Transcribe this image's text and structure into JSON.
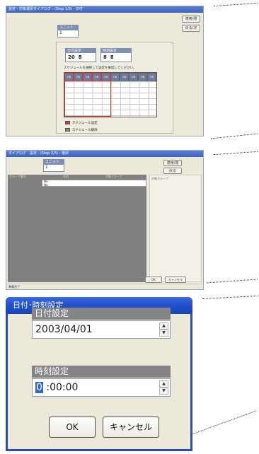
{
  "window1": {
    "title": "設定 - 対象選択ダイアログ - (Step 1/3) - 日付",
    "buttons": [
      "適用/閉",
      "戻る/次"
    ],
    "unit_box": {
      "label": "ユニット",
      "value": "1"
    },
    "date_box": {
      "label": "日付設定",
      "value": "20",
      "month": "8"
    },
    "time_box": {
      "label": "時刻設定",
      "value": "8",
      "minute": "8"
    },
    "hint": "スケジュールを選択して設定を確認してください。",
    "grid_columns": [
      "ON",
      "ON",
      "ON",
      "ON",
      "ON",
      "ON",
      "ON",
      "ON",
      "ON",
      "ON"
    ],
    "legend": [
      "スケジュール設定",
      "スケジュール解除"
    ]
  },
  "window2": {
    "title": "ダイアログ - 設定 - (Step 2/3) - 選択",
    "buttons": [
      "適用/閉",
      "戻る"
    ],
    "unit_box": {
      "label": "ユニット",
      "value": "1"
    },
    "columns": [
      "グループ番号",
      "名前",
      "対象グループ"
    ],
    "rows": [
      "No.",
      "No."
    ],
    "right_panel_header": "対象グループ",
    "ok_label": "OK",
    "cancel_label": "キャンセル",
    "status": "準備完了"
  },
  "dialog": {
    "title": "日付･時刻設定",
    "date_label": "日付設定",
    "date_value": "2003/04/01",
    "time_label": "時刻設定",
    "time_selected": "0",
    "time_rest": " :00:00",
    "ok_label": "OK",
    "cancel_label": "キャンセル"
  },
  "colors": {
    "titlebar": "#2351c9",
    "dialog_border": "#2b4fb3",
    "group_label": "#858585",
    "selection": "#316ac5",
    "highlight_red": "#d23a2a"
  }
}
